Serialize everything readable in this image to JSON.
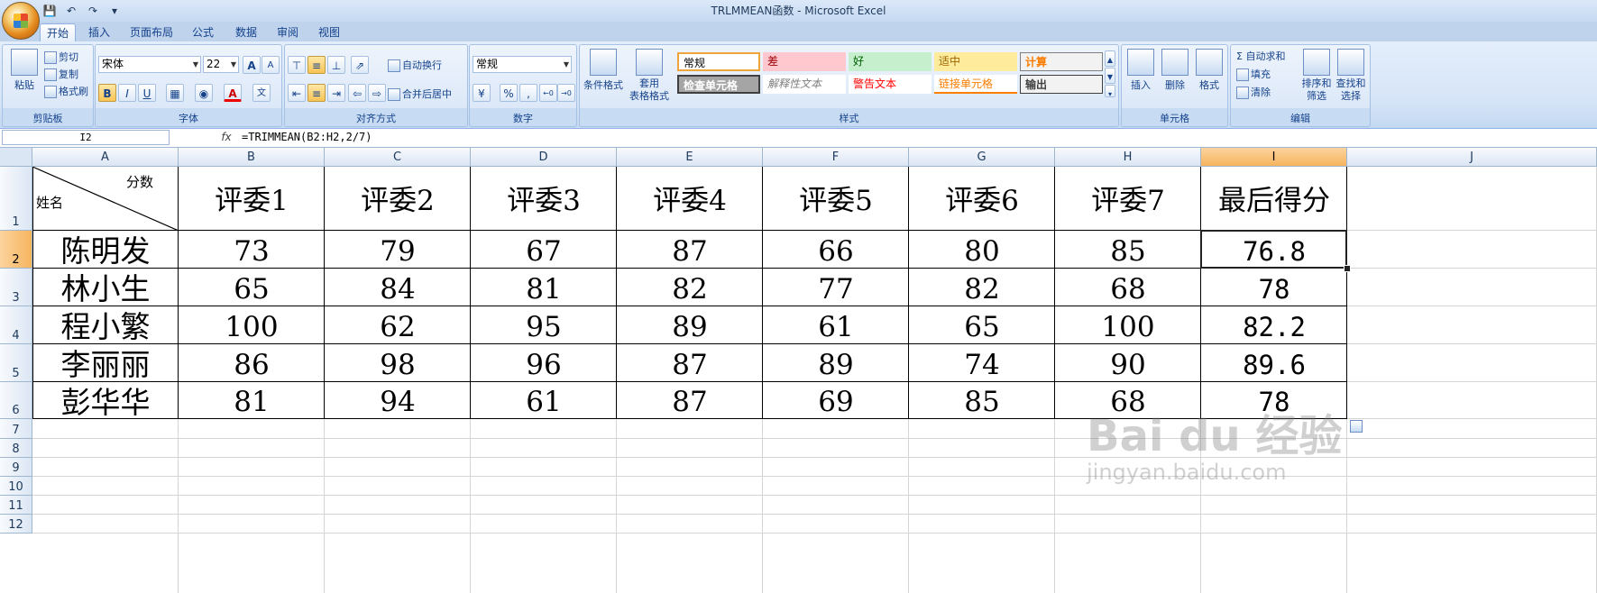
{
  "window": {
    "title": "TRLMMEAN函数 - Microsoft Excel"
  },
  "tabs": [
    "开始",
    "插入",
    "页面布局",
    "公式",
    "数据",
    "审阅",
    "视图"
  ],
  "clipboard": {
    "paste": "粘贴",
    "cut": "剪切",
    "copy": "复制",
    "format_painter": "格式刷",
    "label": "剪贴板"
  },
  "font": {
    "name": "宋体",
    "size": "22",
    "label": "字体",
    "bold": "B",
    "italic": "I",
    "underline": "U",
    "grow": "A",
    "shrink": "A",
    "color_letter": "A",
    "phonetic": "文"
  },
  "alignment": {
    "wrap": "自动换行",
    "merge": "合并后居中",
    "label": "对齐方式"
  },
  "number": {
    "format": "常规",
    "percent": "%",
    "comma": ",",
    "label": "数字"
  },
  "styles": {
    "cond_format": "条件格式",
    "table_format_1": "套用",
    "table_format_2": "表格格式",
    "cells": [
      "常规",
      "差",
      "好",
      "适中",
      "计算",
      "检查单元格",
      "解释性文本",
      "警告文本",
      "链接单元格",
      "输出"
    ],
    "label": "样式"
  },
  "cells_group": {
    "insert": "插入",
    "delete": "删除",
    "format": "格式",
    "label": "单元格"
  },
  "editing": {
    "autosum": "自动求和",
    "fill": "填充",
    "clear": "清除",
    "sort1": "排序和",
    "sort2": "筛选",
    "find1": "查找和",
    "find2": "选择",
    "label": "编辑"
  },
  "formula_bar": {
    "name_box": "I2",
    "fx": "fx",
    "formula": "=TRIMMEAN(B2:H2,2/7)"
  },
  "columns": [
    "A",
    "B",
    "C",
    "D",
    "E",
    "F",
    "G",
    "H",
    "I",
    "J"
  ],
  "rows": [
    "1",
    "2",
    "3",
    "4",
    "5",
    "6",
    "7",
    "8",
    "9",
    "10",
    "11",
    "12"
  ],
  "header": {
    "diag_top": "分数",
    "diag_bottom": "姓名",
    "judges": [
      "评委1",
      "评委2",
      "评委3",
      "评委4",
      "评委5",
      "评委6",
      "评委7"
    ],
    "final": "最后得分"
  },
  "table": [
    {
      "name": "陈明发",
      "scores": [
        "73",
        "79",
        "67",
        "87",
        "66",
        "80",
        "85"
      ],
      "final": "76.8"
    },
    {
      "name": "林小生",
      "scores": [
        "65",
        "84",
        "81",
        "82",
        "77",
        "82",
        "68"
      ],
      "final": "78"
    },
    {
      "name": "程小繁",
      "scores": [
        "100",
        "62",
        "95",
        "89",
        "61",
        "65",
        "100"
      ],
      "final": "82.2"
    },
    {
      "name": "李丽丽",
      "scores": [
        "86",
        "98",
        "96",
        "87",
        "89",
        "74",
        "90"
      ],
      "final": "89.6"
    },
    {
      "name": "彭华华",
      "scores": [
        "81",
        "94",
        "61",
        "87",
        "69",
        "85",
        "68"
      ],
      "final": "78"
    }
  ],
  "watermark": {
    "brand": "Bai du 经验",
    "url": "jingyan.baidu.com"
  }
}
